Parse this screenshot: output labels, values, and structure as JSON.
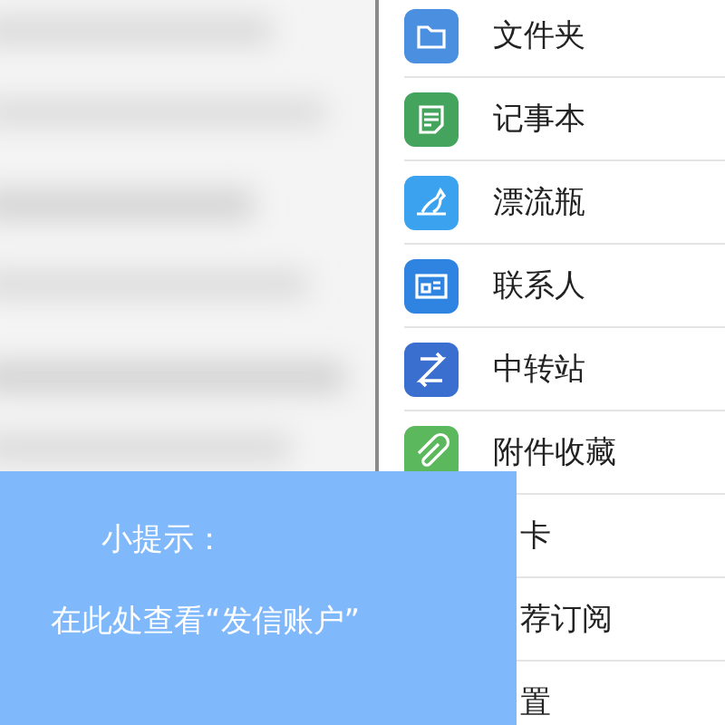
{
  "menu": {
    "items": [
      {
        "label": "文件夹",
        "kind": "folder",
        "color": "#4a8fe0"
      },
      {
        "label": "记事本",
        "kind": "note",
        "color": "#44a35c"
      },
      {
        "label": "漂流瓶",
        "kind": "bird",
        "color": "#3aa2ee"
      },
      {
        "label": "联系人",
        "kind": "contact",
        "color": "#2f84e2"
      },
      {
        "label": "中转站",
        "kind": "transfer",
        "color": "#3b6fcf"
      },
      {
        "label": "附件收藏",
        "kind": "clip",
        "color": "#5cb85c"
      },
      {
        "label": "卡",
        "kind": "covered"
      },
      {
        "label": "荐订阅",
        "kind": "covered"
      },
      {
        "label": "置",
        "kind": "covered"
      }
    ]
  },
  "tip": {
    "title": "小提示：",
    "text": "在此处查看“发信账户”"
  }
}
